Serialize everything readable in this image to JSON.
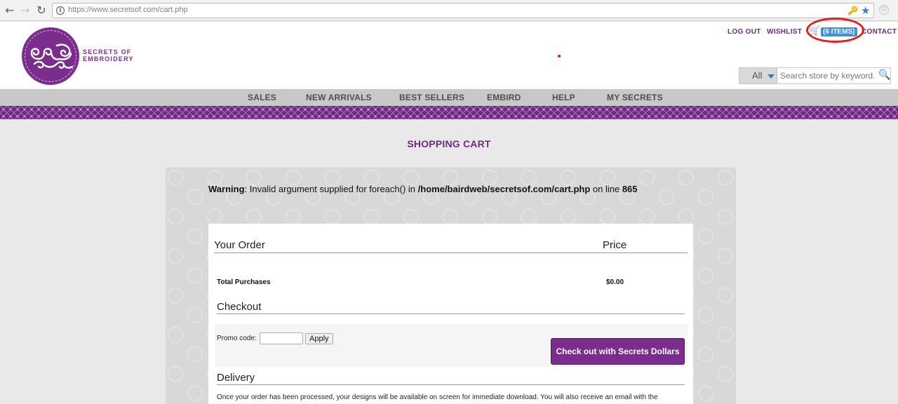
{
  "browser": {
    "url_host": "https://www.secretsof.com",
    "url_path": "/cart.php",
    "back": "←",
    "forward": "→",
    "reload": "↻",
    "info": "i",
    "key": "🔑",
    "star": "★",
    "ext": "☺"
  },
  "header": {
    "logo_line1": "SECRETS OF",
    "logo_line2": "EMBROIDERY",
    "logout": "LOG OUT",
    "wishlist": "WISHLIST",
    "cart_badge": "(6 ITEMS)",
    "contact": "CONTACT",
    "search_category": "All",
    "search_placeholder": "Search store by keyword...",
    "search_icon": "🔍",
    "cart_icon": "🛒"
  },
  "nav": {
    "items": [
      "SALES",
      "NEW ARRIVALS",
      "BEST SELLERS",
      "EMBIRD",
      "HELP",
      "MY SECRETS"
    ]
  },
  "page": {
    "title": "SHOPPING CART",
    "warning_label": "Warning",
    "warning_mid": ": Invalid argument supplied for foreach() in ",
    "warning_path": "/home/bairdweb/secretsof.com/cart.php",
    "warning_on": " on line ",
    "warning_line": "865"
  },
  "order": {
    "your_order": "Your Order",
    "price": "Price",
    "total_label": "Total Purchases",
    "total_value": "$0.00",
    "checkout_heading": "Checkout",
    "promo_label": "Promo code:",
    "promo_value": "",
    "apply": "Apply",
    "checkout_button": "Check out with Secrets Dollars",
    "delivery_heading": "Delivery",
    "delivery_text": "Once your order has been processed, your designs will be available on screen for immediate download. You will also receive an email with the"
  },
  "colors": {
    "brand_purple": "#7b2d8e",
    "highlight_red": "#e01e1e",
    "badge_blue": "#3d8fe0"
  }
}
